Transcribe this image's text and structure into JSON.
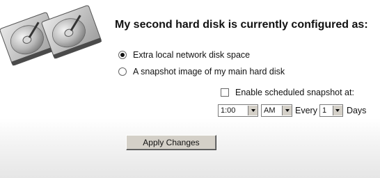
{
  "header": {
    "title": "My second hard disk is currently configured as:",
    "image_icon": "hard-disks-image"
  },
  "options": {
    "extra_space": {
      "label": "Extra local network disk space",
      "selected": true
    },
    "snapshot": {
      "label": "A snapshot image of my main hard disk",
      "selected": false
    }
  },
  "schedule": {
    "enable_label": "Enable scheduled snapshot at:",
    "enabled": false,
    "time": "1:00",
    "ampm": "AM",
    "every_label": "Every",
    "every_value": "1",
    "days_label": "Days"
  },
  "apply_button": {
    "label": "Apply Changes"
  }
}
